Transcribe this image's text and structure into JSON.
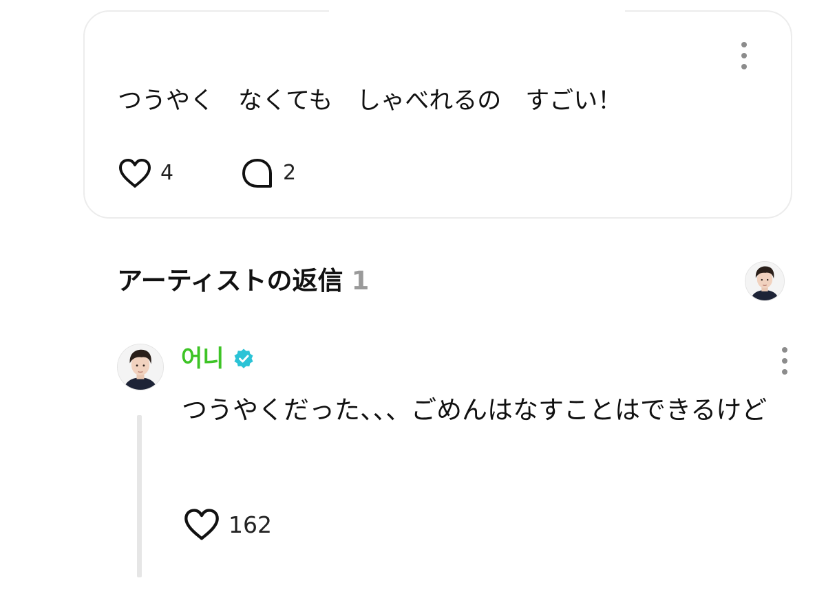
{
  "post": {
    "text": "つうやく　なくても　しゃべれるの　すごい！",
    "like_icon": "heart-outline-icon",
    "like_count": "4",
    "comment_icon": "speech-bubble-icon",
    "comment_count": "2",
    "more_icon": "vertical-dots-icon"
  },
  "artist_replies": {
    "title": "アーティストの返信",
    "count": "1"
  },
  "reply": {
    "author": "어니",
    "author_color": "#3ec426",
    "verified_icon": "verified-badge-icon",
    "verified_color": "#2bc3d6",
    "text": "つうやくだった、、、ごめんはなすことはできるけど",
    "like_count": "162",
    "more_icon": "vertical-dots-icon"
  }
}
